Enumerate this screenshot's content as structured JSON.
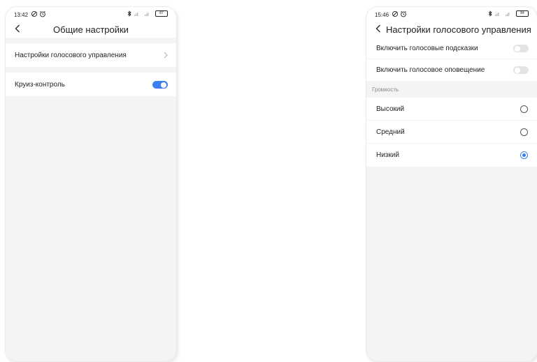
{
  "left_screen": {
    "status": {
      "time": "13:42",
      "battery": "87"
    },
    "title": "Общие настройки",
    "items": [
      {
        "label": "Настройки голосового управления"
      },
      {
        "label": "Круиз-контроль",
        "toggle_on": true
      }
    ]
  },
  "right_screen": {
    "status": {
      "time": "15:46",
      "battery": "84"
    },
    "title": "Настройки голосового управления",
    "toggles": [
      {
        "label": "Включить голосовые подсказки",
        "on": false
      },
      {
        "label": "Включить голосовое оповещение",
        "on": false
      }
    ],
    "volume_label": "Громкость",
    "volume_options": [
      {
        "label": "Высокий",
        "selected": false
      },
      {
        "label": "Средний",
        "selected": false
      },
      {
        "label": "Низкий",
        "selected": true
      }
    ]
  },
  "colors": {
    "accent": "#3b7ff2",
    "background": "#f4f4f6"
  },
  "icons": [
    "back-arrow-icon",
    "chevron-right-icon",
    "bluetooth-icon",
    "signal-icon",
    "battery-icon",
    "alarm-icon",
    "data-saver-icon"
  ]
}
